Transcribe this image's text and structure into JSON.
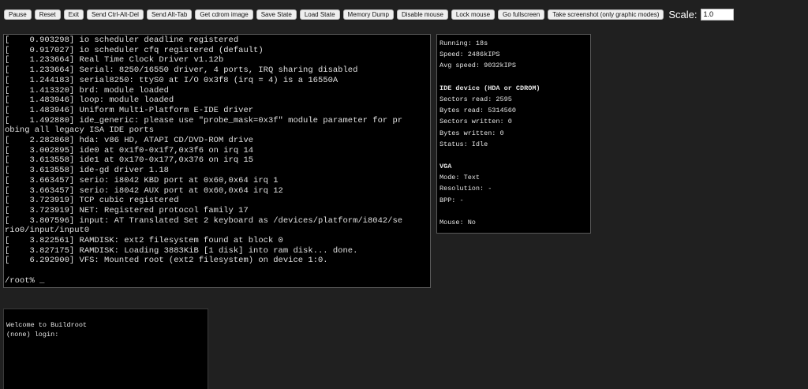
{
  "toolbar": {
    "buttons": [
      "Pause",
      "Reset",
      "Exit",
      "Send Ctrl-Alt-Del",
      "Send Alt-Tab",
      "Get cdrom image",
      "Save State",
      "Load State",
      "Memory Dump",
      "Disable mouse",
      "Lock mouse",
      "Go fullscreen",
      "Take screenshot (only graphic modes)"
    ],
    "scale_label": "Scale:",
    "scale_value": "1.0"
  },
  "terminal": {
    "lines": [
      "[    0.903298] io scheduler deadline registered",
      "[    0.917027] io scheduler cfq registered (default)",
      "[    1.233664] Real Time Clock Driver v1.12b",
      "[    1.233664] Serial: 8250/16550 driver, 4 ports, IRQ sharing disabled",
      "[    1.244183] serial8250: ttyS0 at I/O 0x3f8 (irq = 4) is a 16550A",
      "[    1.413320] brd: module loaded",
      "[    1.483946] loop: module loaded",
      "[    1.483946] Uniform Multi-Platform E-IDE driver",
      "[    1.492880] ide_generic: please use \"probe_mask=0x3f\" module parameter for pr",
      "obing all legacy ISA IDE ports",
      "[    2.282868] hda: v86 HD, ATAPI CD/DVD-ROM drive",
      "[    3.002895] ide0 at 0x1f0-0x1f7,0x3f6 on irq 14",
      "[    3.613558] ide1 at 0x170-0x177,0x376 on irq 15",
      "[    3.613558] ide-gd driver 1.18",
      "[    3.663457] serio: i8042 KBD port at 0x60,0x64 irq 1",
      "[    3.663457] serio: i8042 AUX port at 0x60,0x64 irq 12",
      "[    3.723919] TCP cubic registered",
      "[    3.723919] NET: Registered protocol family 17",
      "[    3.807596] input: AT Translated Set 2 keyboard as /devices/platform/i8042/se",
      "rio0/input/input0",
      "[    3.822561] RAMDISK: ext2 filesystem found at block 0",
      "[    3.827175] RAMDISK: Loading 3883KiB [1 disk] into ram disk... done.",
      "[    6.292900] VFS: Mounted root (ext2 filesystem) on device 1:0.",
      "",
      "/root% _"
    ]
  },
  "stats": {
    "running": "Running: 18s",
    "speed": "Speed: 2486kIPS",
    "avg_speed": "Avg speed: 9032kIPS",
    "ide_header": "IDE device (HDA or CDROM)",
    "sectors_read": "Sectors read: 2595",
    "bytes_read": "Bytes read: 5314560",
    "sectors_written": "Sectors written: 0",
    "bytes_written": "Bytes written: 0",
    "status": "Status: Idle",
    "vga_header": "VGA",
    "mode": "Mode: Text",
    "resolution": "Resolution: -",
    "bpp": "BPP: -",
    "mouse": "Mouse: No"
  },
  "login": {
    "welcome": "Welcome to Buildroot",
    "prompt": "(none) login:"
  }
}
